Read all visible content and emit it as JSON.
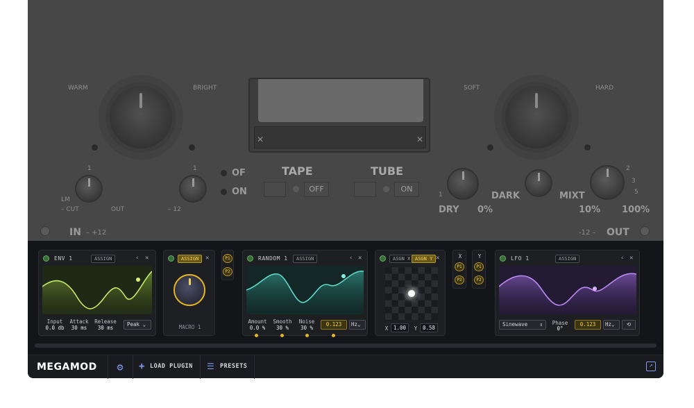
{
  "plugin": {
    "labels": {
      "warm": "WARM",
      "bright": "BRIGHT",
      "soft": "SOFT",
      "hard": "HARD",
      "lm": "LM",
      "cut": "– CUT",
      "out_small": "OUT",
      "minus12": "– 12",
      "plus12b": "+12",
      "one_a": "1",
      "one_b": "1",
      "of": "OF",
      "on": "ON",
      "tape": "TAPE",
      "tube": "TUBE",
      "off_btn": "OFF",
      "on_btn": "ON",
      "dark": "DARK",
      "mixt": "MIXT",
      "dry": "DRY",
      "pct0": "0%",
      "pct10": "10%",
      "pct100": "100%",
      "in_label": "IN",
      "in_val": "– +12",
      "out_val": "-12 –",
      "out_label": "OUT",
      "x1": "✕",
      "x2": "✕",
      "one_c": "1",
      "two": "2",
      "three": "3",
      "five": "5"
    }
  },
  "megamod": {
    "env": {
      "title": "ENV 1",
      "assign": "ASSIGN",
      "params": [
        {
          "label": "Input",
          "value": "0.0 db"
        },
        {
          "label": "Attack",
          "value": "30 ms"
        },
        {
          "label": "Release",
          "value": "30 ms"
        }
      ],
      "mode": "Peak"
    },
    "macro": {
      "assign": "ASSIGN",
      "label": "MACRO 1",
      "slots": [
        "P1",
        "P2"
      ]
    },
    "random": {
      "title": "RANDOM 1",
      "assign": "ASSIGN",
      "params": [
        {
          "label": "Amount",
          "value": "0.0 %"
        },
        {
          "label": "Smooth",
          "value": "30 %"
        },
        {
          "label": "Noise",
          "value": "30 %"
        }
      ],
      "rate": "0.123",
      "unit": "Hz"
    },
    "xy": {
      "assign_x": "ASGN X",
      "assign_y": "ASGN Y",
      "x_label": "X",
      "x_value": "1.00",
      "y_label": "Y",
      "y_value": "0.58",
      "col_x": "X",
      "col_y": "Y",
      "slots_x": [
        "P1",
        "P2"
      ],
      "slots_y": [
        "P1",
        "P2"
      ]
    },
    "lfo": {
      "title": "LFO 1",
      "assign": "ASSIGN",
      "shape": "Sinewave",
      "phase_label": "Phase",
      "phase_value": "0°",
      "rate": "0.123",
      "unit": "Hz"
    },
    "bottom": {
      "logo": "MEGAMOD",
      "load_plugin": "LOAD PLUGIN",
      "presets": "PRESETS"
    },
    "colors": {
      "env": "#c8e86a",
      "random": "#5fd6c6",
      "lfo": "#b98af0",
      "accent": "#e5b523"
    }
  }
}
